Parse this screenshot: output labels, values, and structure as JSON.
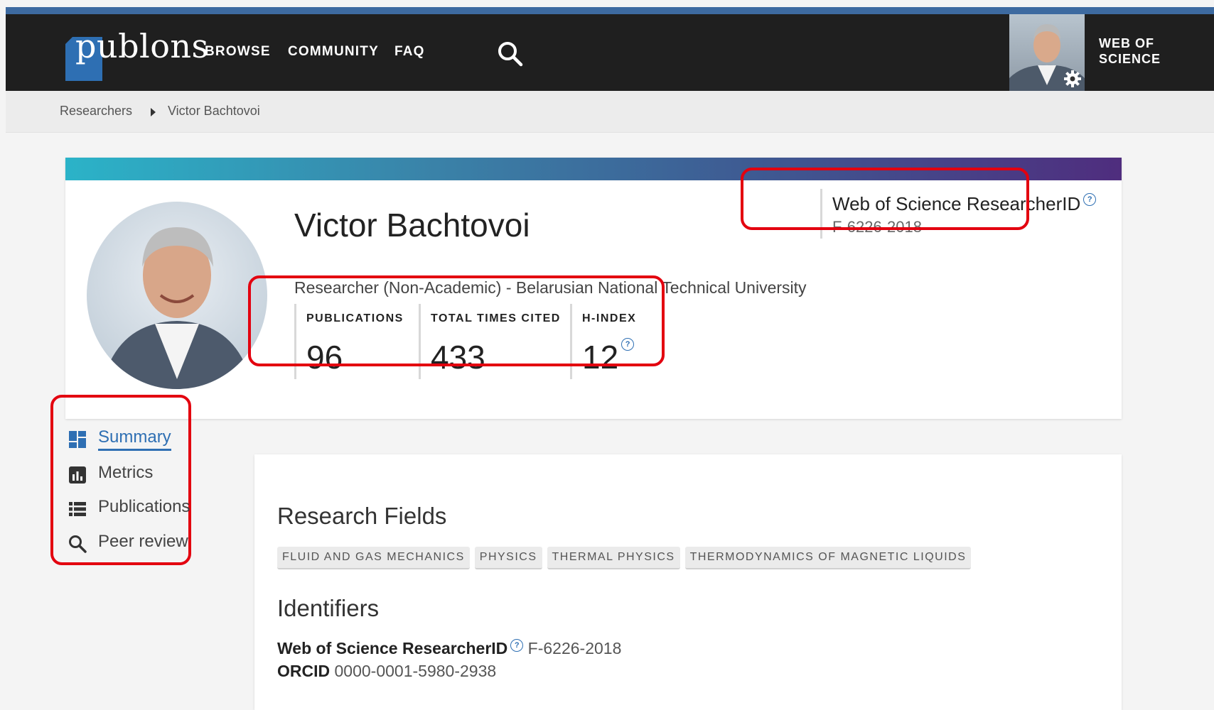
{
  "nav": {
    "logo": "publons",
    "items": [
      "BROWSE",
      "COMMUNITY",
      "FAQ"
    ],
    "web_of_science_line1": "WEB OF",
    "web_of_science_line2": "SCIENCE"
  },
  "breadcrumb": {
    "parent": "Researchers",
    "current": "Victor Bachtovoi"
  },
  "profile": {
    "name": "Victor Bachtovoi",
    "affiliation": "Researcher (Non-Academic) - Belarusian National Technical University",
    "researcher_id_title": "Web of Science ResearcherID",
    "researcher_id": "F-6226-2018",
    "stats": [
      {
        "label": "PUBLICATIONS",
        "value": "96"
      },
      {
        "label": "TOTAL TIMES CITED",
        "value": "433"
      },
      {
        "label": "H-INDEX",
        "value": "12"
      }
    ]
  },
  "sidenav": {
    "items": [
      {
        "label": "Summary",
        "icon": "dashboard-icon",
        "active": true
      },
      {
        "label": "Metrics",
        "icon": "bar-chart-icon",
        "active": false
      },
      {
        "label": "Publications",
        "icon": "list-icon",
        "active": false
      },
      {
        "label": "Peer review",
        "icon": "search-icon",
        "active": false
      }
    ]
  },
  "summary": {
    "research_fields_title": "Research Fields",
    "fields": [
      "FLUID AND GAS MECHANICS",
      "PHYSICS",
      "THERMAL PHYSICS",
      "THERMODYNAMICS OF MAGNETIC LIQUIDS"
    ],
    "identifiers_title": "Identifiers",
    "wos_label": "Web of Science ResearcherID",
    "wos_value": "F-6226-2018",
    "orcid_label": "ORCID",
    "orcid_value": "0000-0001-5980-2938"
  },
  "colors": {
    "accent": "#2e6fb3",
    "highlight": "#e3000f",
    "navbar": "#1f1f1f"
  }
}
